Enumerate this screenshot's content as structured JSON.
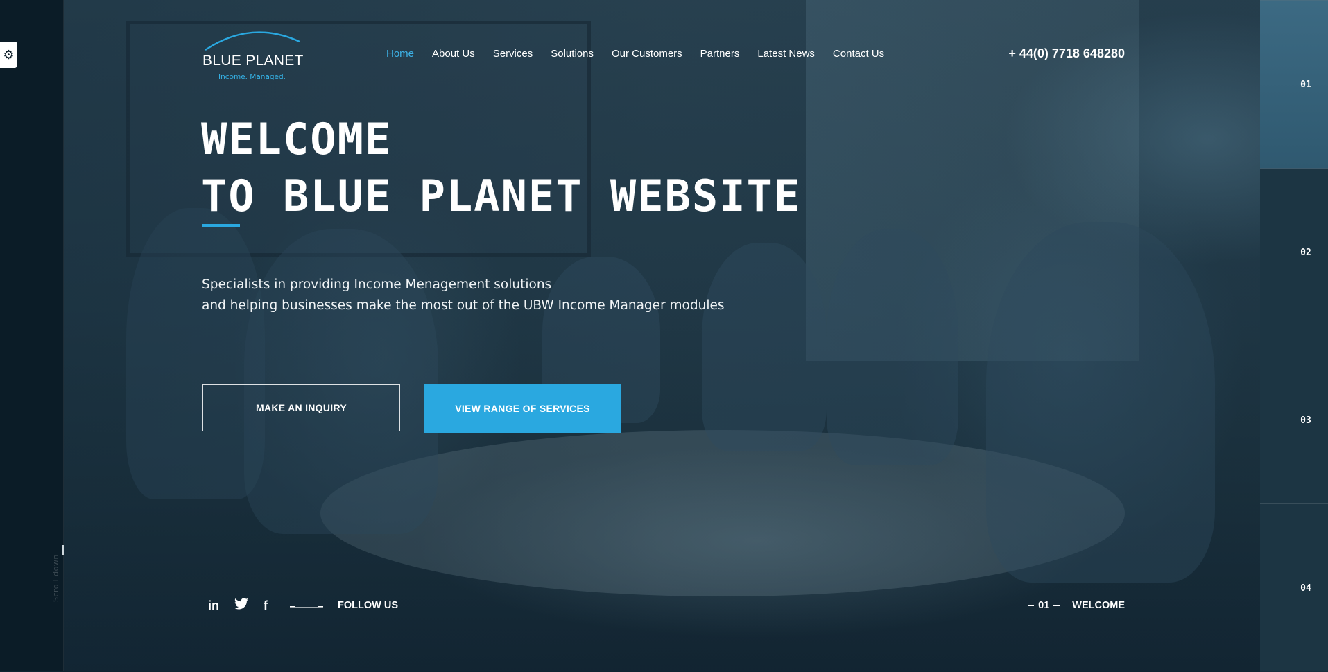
{
  "brand": {
    "name": "BLUE PLANET",
    "tagline": "Income. Managed.",
    "accent_color": "#2aa8e0"
  },
  "nav": {
    "items": [
      {
        "label": "Home",
        "active": true
      },
      {
        "label": "About Us"
      },
      {
        "label": "Services"
      },
      {
        "label": "Solutions"
      },
      {
        "label": "Our Customers"
      },
      {
        "label": "Partners"
      },
      {
        "label": "Latest News"
      },
      {
        "label": "Contact Us"
      }
    ]
  },
  "phone": "+ 44(0) 7718 648280",
  "hero": {
    "title_line1": "WELCOME",
    "title_line2": "TO BLUE PLANET WEBSITE",
    "subtitle_line1": "Specialists in providing Income Menagement solutions",
    "subtitle_line2": "and helping businesses make the most out of the UBW Income Manager modules",
    "primary_button": "MAKE AN INQUIRY",
    "secondary_button": "VIEW RANGE OF SERVICES"
  },
  "social": {
    "icons": [
      "linkedin-icon",
      "twitter-icon",
      "facebook-icon"
    ],
    "linkedin_glyph": "in",
    "twitter_glyph": "🐦",
    "facebook_glyph": "f",
    "follow_label": "FOLLOW US"
  },
  "slide": {
    "current_number": "01",
    "current_label": "WELCOME"
  },
  "slide_tabs": [
    "01",
    "02",
    "03",
    "04"
  ],
  "side": {
    "scroll_label": "Scroll down",
    "settings_glyph": "⚙"
  }
}
